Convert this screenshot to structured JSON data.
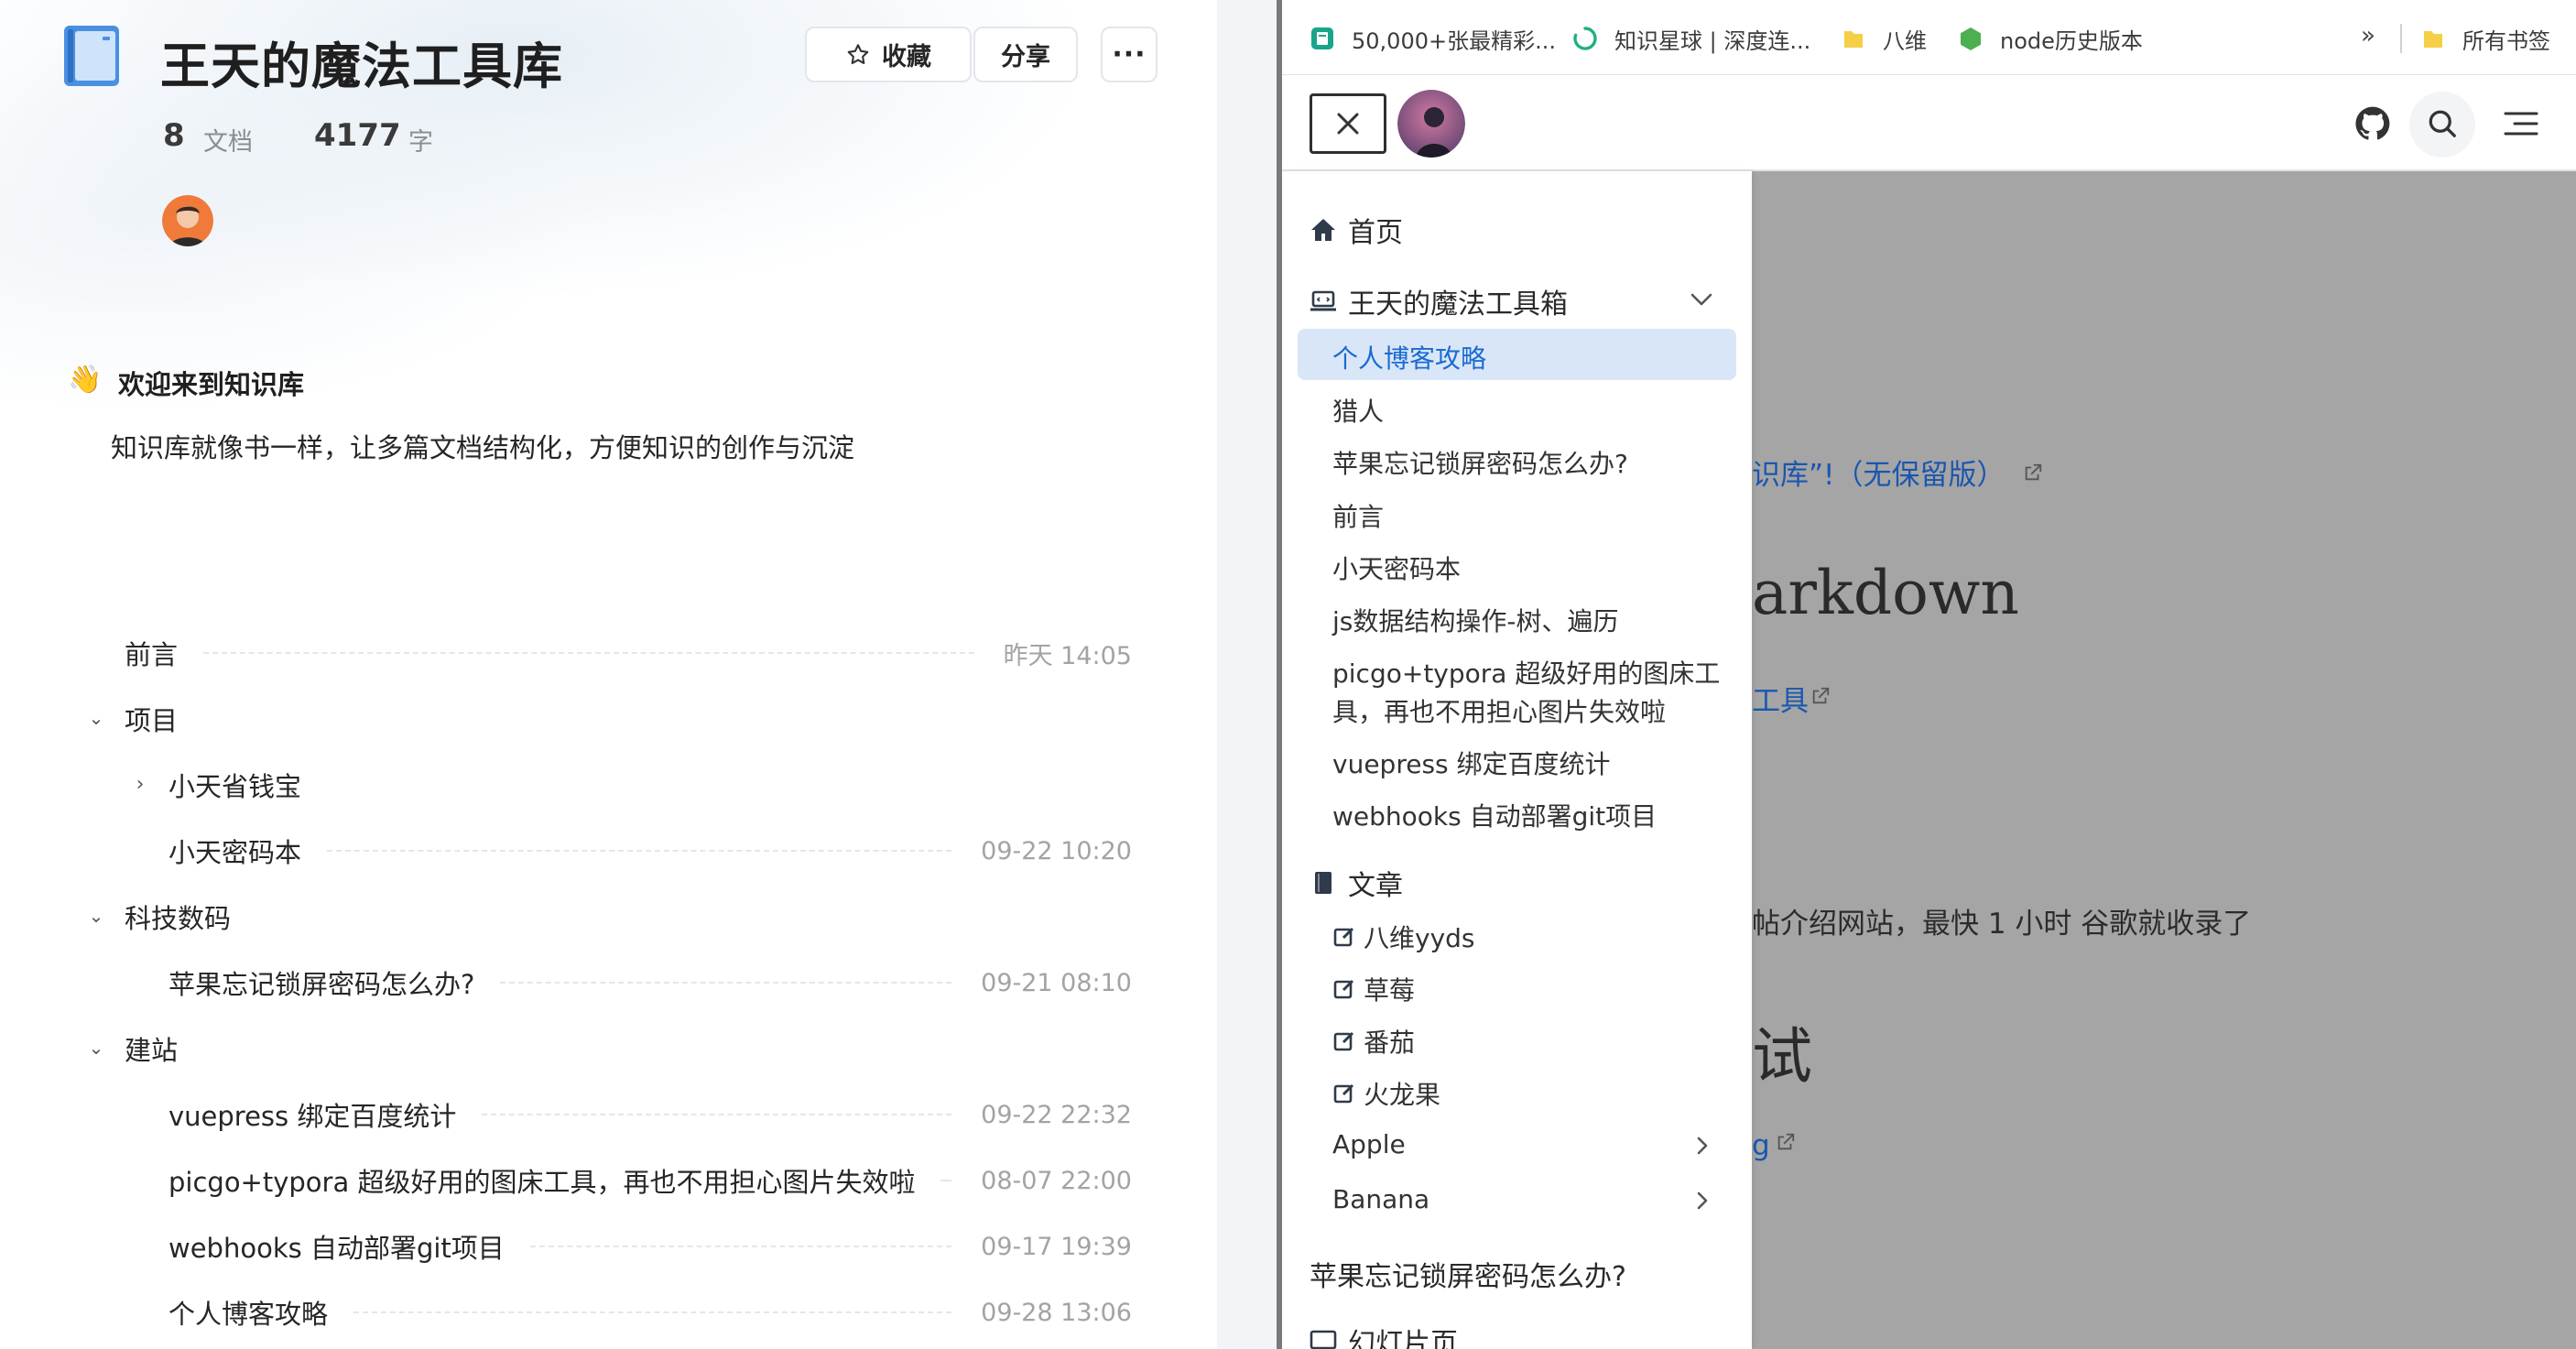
{
  "kb": {
    "title": "王天的魔法工具库",
    "fav_label": "收藏",
    "share_label": "分享",
    "more_label": "···",
    "doc_count": "8",
    "doc_unit": "文档",
    "word_count": "4177",
    "word_unit": "字",
    "welcome_emoji": "👋",
    "welcome_title": "欢迎来到知识库",
    "welcome_desc": "知识库就像书一样，让多篇文档结构化，方便知识的创作与沉淀",
    "toc": [
      {
        "label": "前言",
        "time": "昨天 14:05"
      },
      {
        "label": "项目"
      },
      {
        "label": "小天省钱宝"
      },
      {
        "label": "小天密码本",
        "time": "09-22 10:20"
      },
      {
        "label": "科技数码"
      },
      {
        "label": "苹果忘记锁屏密码怎么办?",
        "time": "09-21 08:10"
      },
      {
        "label": "建站"
      },
      {
        "label": "vuepress 绑定百度统计",
        "time": "09-22 22:32"
      },
      {
        "label": "picgo+typora 超级好用的图床工具，再也不用担心图片失效啦",
        "time": "08-07 22:00"
      },
      {
        "label": "webhooks 自动部署git项目",
        "time": "09-17 19:39"
      },
      {
        "label": "个人博客攻略",
        "time": "09-28 13:06"
      }
    ]
  },
  "browser": {
    "bookmarks": [
      {
        "label": "50,000+张最精彩...",
        "icon": "page-icon"
      },
      {
        "label": "知识星球 | 深度连...",
        "icon": "loading-icon"
      },
      {
        "label": "八维",
        "icon": "folder-icon"
      },
      {
        "label": "node历史版本",
        "icon": "node-icon"
      }
    ],
    "more_bookmarks": "»",
    "all_bookmarks": "所有书签",
    "sidebar": {
      "home": "首页",
      "group_tools": "王天的魔法工具箱",
      "tools_items": [
        "个人博客攻略",
        "猎人",
        "苹果忘记锁屏密码怎么办?",
        "前言",
        "小天密码本",
        "js数据结构操作-树、遍历",
        "picgo+typora 超级好用的图床工",
        "具，再也不用担心图片失效啦",
        "vuepress 绑定百度统计",
        "webhooks 自动部署git项目"
      ],
      "group_articles": "文章",
      "article_items": [
        "八维yyds",
        "草莓",
        "番茄",
        "火龙果"
      ],
      "sub_groups": [
        "Apple",
        "Banana"
      ],
      "bottom_item": "苹果忘记锁屏密码怎么办?",
      "slides": "幻灯片页"
    },
    "content": {
      "link1": "识库”!（无保留版）",
      "heading1": "arkdown",
      "link2": "工具",
      "para": "帖介绍网站，最快 1 小时 谷歌就收录了",
      "heading2": "试",
      "link3": "g"
    }
  },
  "colors": {
    "active_bg": "#d9e6f7",
    "link": "#1a56b0",
    "overlay": "#a5a5a5",
    "time_text": "#a3a3a3"
  }
}
